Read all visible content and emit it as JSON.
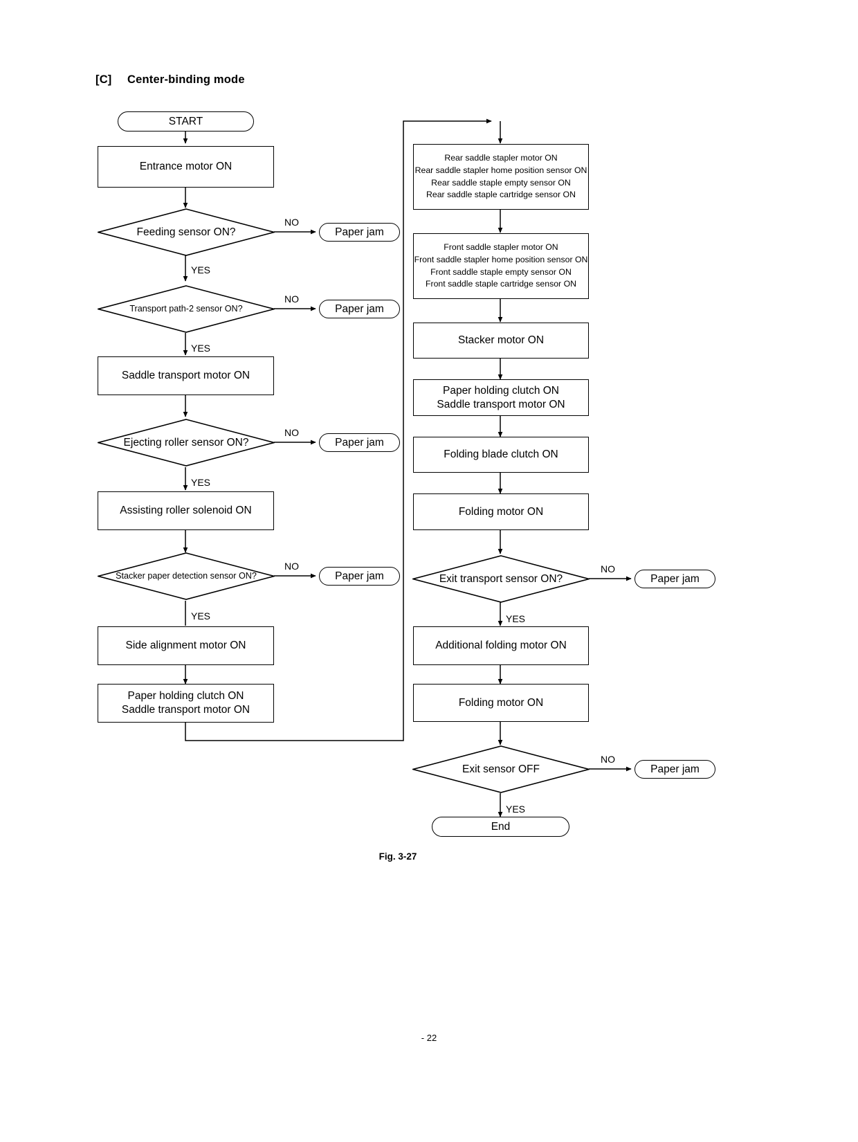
{
  "heading": {
    "tag": "[C]",
    "title": "Center-binding mode"
  },
  "caption": "Fig. 3-27",
  "footer": "- 22",
  "colors": {
    "line": "#000000",
    "background": "#ffffff"
  },
  "edge_labels": {
    "no": "NO",
    "yes": "YES"
  },
  "flow": {
    "left_column": [
      {
        "id": "start",
        "type": "terminator",
        "text": "START"
      },
      {
        "id": "entrance",
        "type": "process",
        "text": "Entrance motor ON"
      },
      {
        "id": "feeding",
        "type": "decision",
        "text": "Feeding sensor ON?",
        "no": "Paper jam",
        "yes": "YES"
      },
      {
        "id": "transport2",
        "type": "decision",
        "text": "Transport path-2 sensor ON?",
        "no": "Paper jam",
        "yes": "YES"
      },
      {
        "id": "saddletrans",
        "type": "process",
        "text": "Saddle transport motor ON"
      },
      {
        "id": "ejecting",
        "type": "decision",
        "text": "Ejecting roller sensor ON?",
        "no": "Paper jam",
        "yes": "YES"
      },
      {
        "id": "assisting",
        "type": "process",
        "text": "Assisting roller solenoid ON"
      },
      {
        "id": "stackerpaper",
        "type": "decision",
        "text": "Stacker paper detection sensor ON?",
        "no": "Paper jam",
        "yes": "YES"
      },
      {
        "id": "sidealign",
        "type": "process",
        "text": "Side alignment motor ON"
      },
      {
        "id": "holdclutch1",
        "type": "process",
        "line1": "Paper holding clutch ON",
        "line2": "Saddle transport motor ON"
      }
    ],
    "right_column": [
      {
        "id": "rearsaddle",
        "type": "process",
        "line1": "Rear saddle stapler motor ON",
        "line2": "Rear saddle stapler home position sensor ON",
        "line3": "Rear saddle staple empty sensor ON",
        "line4": "Rear saddle staple cartridge sensor  ON"
      },
      {
        "id": "frontsaddle",
        "type": "process",
        "line1": "Front saddle stapler motor ON",
        "line2": "Front saddle stapler home position sensor ON",
        "line3": "Front saddle staple empty sensor ON",
        "line4": "Front saddle staple cartridge sensor  ON"
      },
      {
        "id": "stackermotor",
        "type": "process",
        "text": "Stacker motor ON"
      },
      {
        "id": "holdclutch2",
        "type": "process",
        "line1": "Paper holding clutch ON",
        "line2": "Saddle transport motor ON"
      },
      {
        "id": "foldblade",
        "type": "process",
        "text": "Folding blade clutch ON"
      },
      {
        "id": "foldmotor1",
        "type": "process",
        "text": "Folding motor ON"
      },
      {
        "id": "exittransport",
        "type": "decision",
        "text": "Exit transport sensor ON?",
        "no": "Paper jam",
        "yes": "YES"
      },
      {
        "id": "addfold",
        "type": "process",
        "text": "Additional folding motor ON"
      },
      {
        "id": "foldmotor2",
        "type": "process",
        "text": "Folding motor ON"
      },
      {
        "id": "exitsensor",
        "type": "decision",
        "text": "Exit sensor OFF",
        "no": "Paper jam",
        "yes": "YES"
      },
      {
        "id": "end",
        "type": "terminator",
        "text": "End"
      }
    ]
  }
}
